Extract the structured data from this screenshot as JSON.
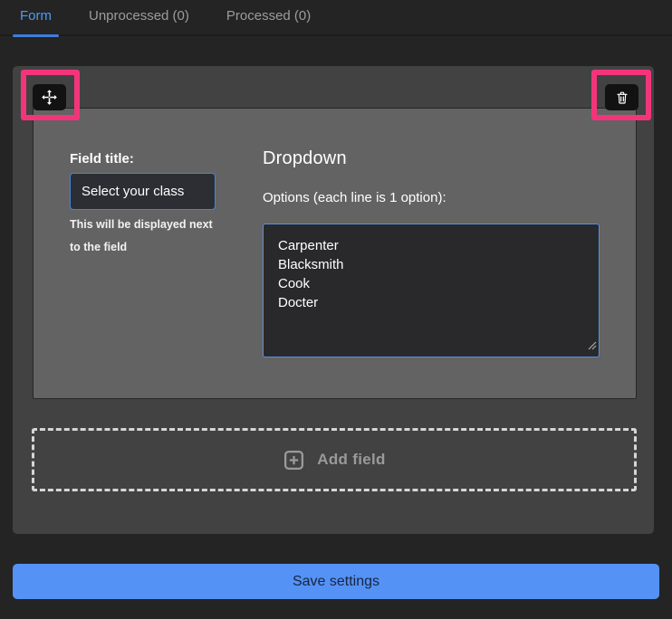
{
  "tabs": [
    {
      "label": "Form",
      "active": true
    },
    {
      "label": "Unprocessed (0)",
      "active": false
    },
    {
      "label": "Processed (0)",
      "active": false
    }
  ],
  "field_editor": {
    "type_heading": "Dropdown",
    "field_title_label": "Field title:",
    "field_title_value": "Select your class",
    "field_title_help": "This will be displayed next to the field",
    "options_label": "Options (each line is 1 option):",
    "options_value": "Carpenter\nBlacksmith\nCook\nDocter",
    "icons": {
      "move": "move-icon",
      "trash": "trash-icon"
    }
  },
  "add_field": {
    "label": "Add field",
    "icon": "plus-square-icon"
  },
  "save_button_label": "Save settings",
  "colors": {
    "page_background": "#242424",
    "panel_background": "#424242",
    "card_background": "#636363",
    "tab_active": "#4c9bf5",
    "tab_underline": "#3e7edc",
    "input_border": "#4d82d6",
    "textarea_border": "#5c8fdb",
    "highlight_pink": "#f2357b",
    "save_button": "#5492f6",
    "icon_button_background": "#121212"
  }
}
